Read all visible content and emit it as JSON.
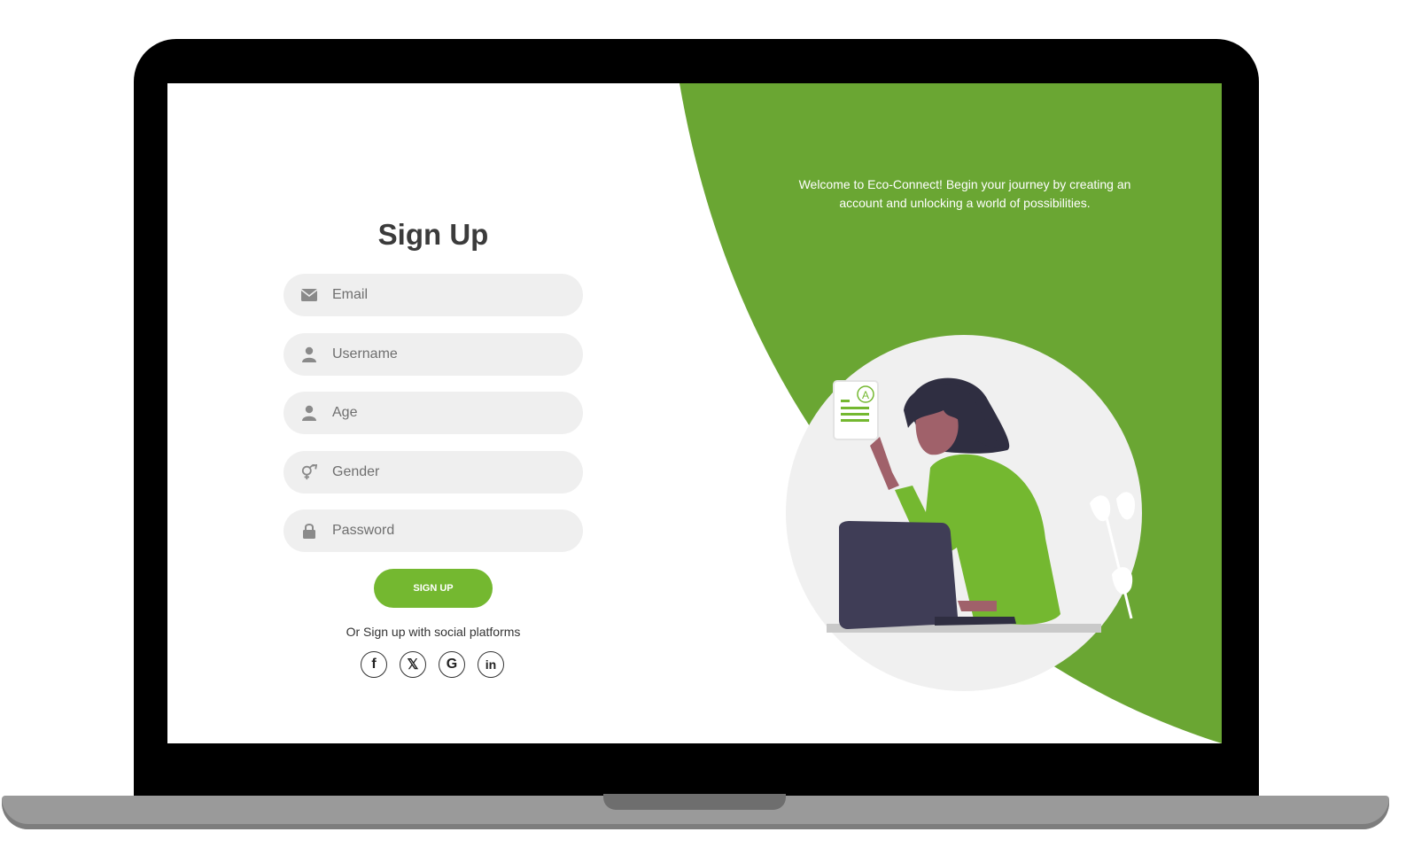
{
  "form": {
    "title": "Sign Up",
    "fields": [
      {
        "placeholder": "Email",
        "icon": "envelope-icon"
      },
      {
        "placeholder": "Username",
        "icon": "user-icon"
      },
      {
        "placeholder": "Age",
        "icon": "user-icon"
      },
      {
        "placeholder": "Gender",
        "icon": "gender-icon"
      },
      {
        "placeholder": "Password",
        "icon": "lock-icon"
      }
    ],
    "submit_label": "SIGN UP",
    "social_text": "Or Sign up with social platforms",
    "social": [
      {
        "label": "f",
        "icon": "facebook-icon"
      },
      {
        "label": "𝕏",
        "icon": "x-icon"
      },
      {
        "label": "G",
        "icon": "google-icon"
      },
      {
        "label": "in",
        "icon": "linkedin-icon"
      }
    ]
  },
  "panel": {
    "welcome": "Welcome to Eco-Connect! Begin your journey by creating an account and unlocking a world of possibilities."
  },
  "colors": {
    "accent": "#74b830",
    "panel_green": "#6aa633",
    "field_bg": "#efefef"
  }
}
